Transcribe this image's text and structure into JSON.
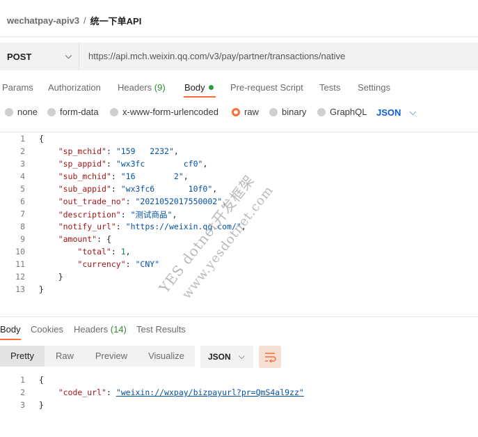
{
  "breadcrumb": {
    "workspace": "wechatpay-apiv3",
    "separator": "/",
    "request": "统一下单API"
  },
  "request": {
    "method": "POST",
    "url": "https://api.mch.weixin.qq.com/v3/pay/partner/transactions/native"
  },
  "request_tabs": {
    "params": "Params",
    "authorization": "Authorization",
    "headers": "Headers",
    "headers_count": "(9)",
    "body": "Body",
    "prerequest": "Pre-request Script",
    "tests": "Tests",
    "settings": "Settings"
  },
  "body_modes": {
    "none": "none",
    "formdata": "form-data",
    "urlencoded": "x-www-form-urlencoded",
    "raw": "raw",
    "binary": "binary",
    "graphql": "GraphQL",
    "language": "JSON",
    "selected": "raw"
  },
  "request_body": {
    "line_numbers": [
      "1",
      "2",
      "3",
      "4",
      "5",
      "6",
      "7",
      "8",
      "9",
      "10",
      "11",
      "12",
      "13"
    ],
    "open_brace": "{",
    "close_brace": "}",
    "keys": {
      "sp_mchid": "\"sp_mchid\"",
      "sp_appid": "\"sp_appid\"",
      "sub_mchid": "\"sub_mchid\"",
      "sub_appid": "\"sub_appid\"",
      "out_trade_no": "\"out_trade_no\"",
      "description": "\"description\"",
      "notify_url": "\"notify_url\"",
      "amount": "\"amount\"",
      "total": "\"total\"",
      "currency": "\"currency\""
    },
    "values": {
      "sp_mchid": "\"159   2232\"",
      "sp_appid": "\"wx3fc        cf0\"",
      "sub_mchid": "\"16        2\"",
      "sub_appid": "\"wx3fc6       10f0\"",
      "out_trade_no": "\"2021052017550002\"",
      "description": "\"测试商品\"",
      "notify_url": "\"https://weixin.qq.com/\"",
      "total": "1",
      "currency": "\"CNY\""
    }
  },
  "response_tabs": {
    "body": "Body",
    "cookies": "Cookies",
    "headers": "Headers",
    "headers_count": "(14)",
    "test_results": "Test Results"
  },
  "response_view": {
    "pretty": "Pretty",
    "raw": "Raw",
    "preview": "Preview",
    "visualize": "Visualize",
    "format": "JSON"
  },
  "response_body": {
    "line_numbers": [
      "1",
      "2",
      "3"
    ],
    "open_brace": "{",
    "close_brace": "}",
    "key": "\"code_url\"",
    "value": "\"weixin://wxpay/bizpayurl?pr=QmS4al9zz\""
  },
  "watermark": {
    "line1": "YES dotnet开发框架",
    "line2": "www.yesdotnet.com"
  },
  "colors": {
    "accent": "#ff6c37",
    "active_dot": "#2a9d3b",
    "count_green": "#2e8b2e",
    "link_blue": "#0b5fd1",
    "json_key": "#a31515",
    "json_string": "#0451a5",
    "json_number": "#098658"
  }
}
